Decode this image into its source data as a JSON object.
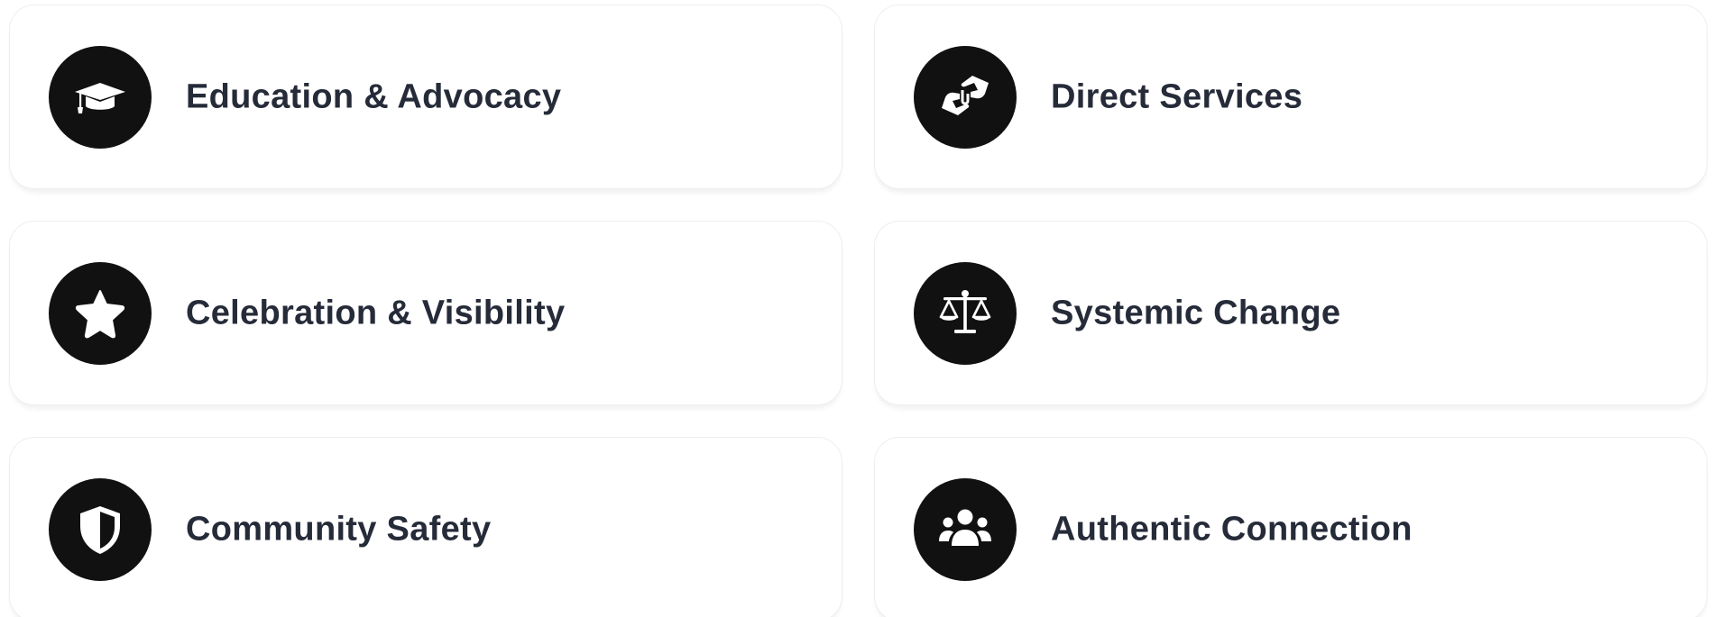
{
  "cards": [
    {
      "label": "Education & Advocacy",
      "icon": "graduation-cap-icon"
    },
    {
      "label": "Direct Services",
      "icon": "hand-holding-hand-icon"
    },
    {
      "label": "Celebration & Visibility",
      "icon": "star-icon"
    },
    {
      "label": "Systemic Change",
      "icon": "scale-balance-icon"
    },
    {
      "label": "Community Safety",
      "icon": "shield-icon"
    },
    {
      "label": "Authentic Connection",
      "icon": "people-group-icon"
    }
  ],
  "colors": {
    "icon_background": "#111111",
    "icon_foreground": "#ffffff",
    "label_text": "#262b39",
    "card_border": "#eeeeee",
    "card_background": "#ffffff"
  }
}
